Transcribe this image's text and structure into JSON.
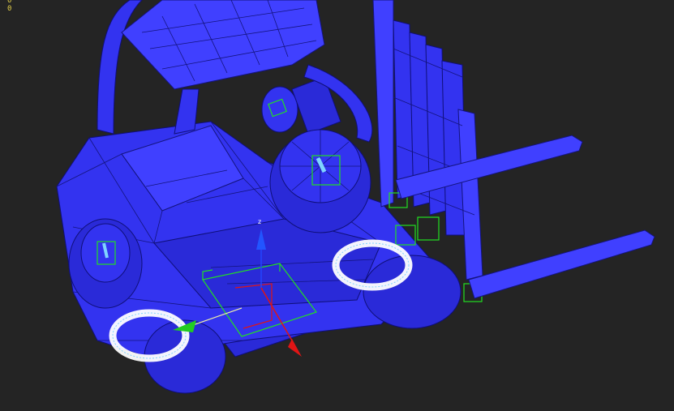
{
  "viewport": {
    "stats": {
      "line1": "0",
      "line2": "0"
    },
    "colors": {
      "background": "#242424",
      "mesh": "#3333f0",
      "wire": "#0f0f78",
      "helper": "#22e022",
      "selection": "#ffffff",
      "axis_x": "#e01515",
      "axis_y": "#22cc22",
      "axis_z": "#2244ff",
      "stat_text": "#e8d34a"
    },
    "objects": [
      "forklift-mesh",
      "rear-wheel-left",
      "rear-wheel-right",
      "steering-wheel",
      "overhead-guard",
      "mast",
      "fork-upper",
      "fork-lower",
      "selection-ring-left",
      "selection-ring-right",
      "transform-gizmo"
    ]
  }
}
